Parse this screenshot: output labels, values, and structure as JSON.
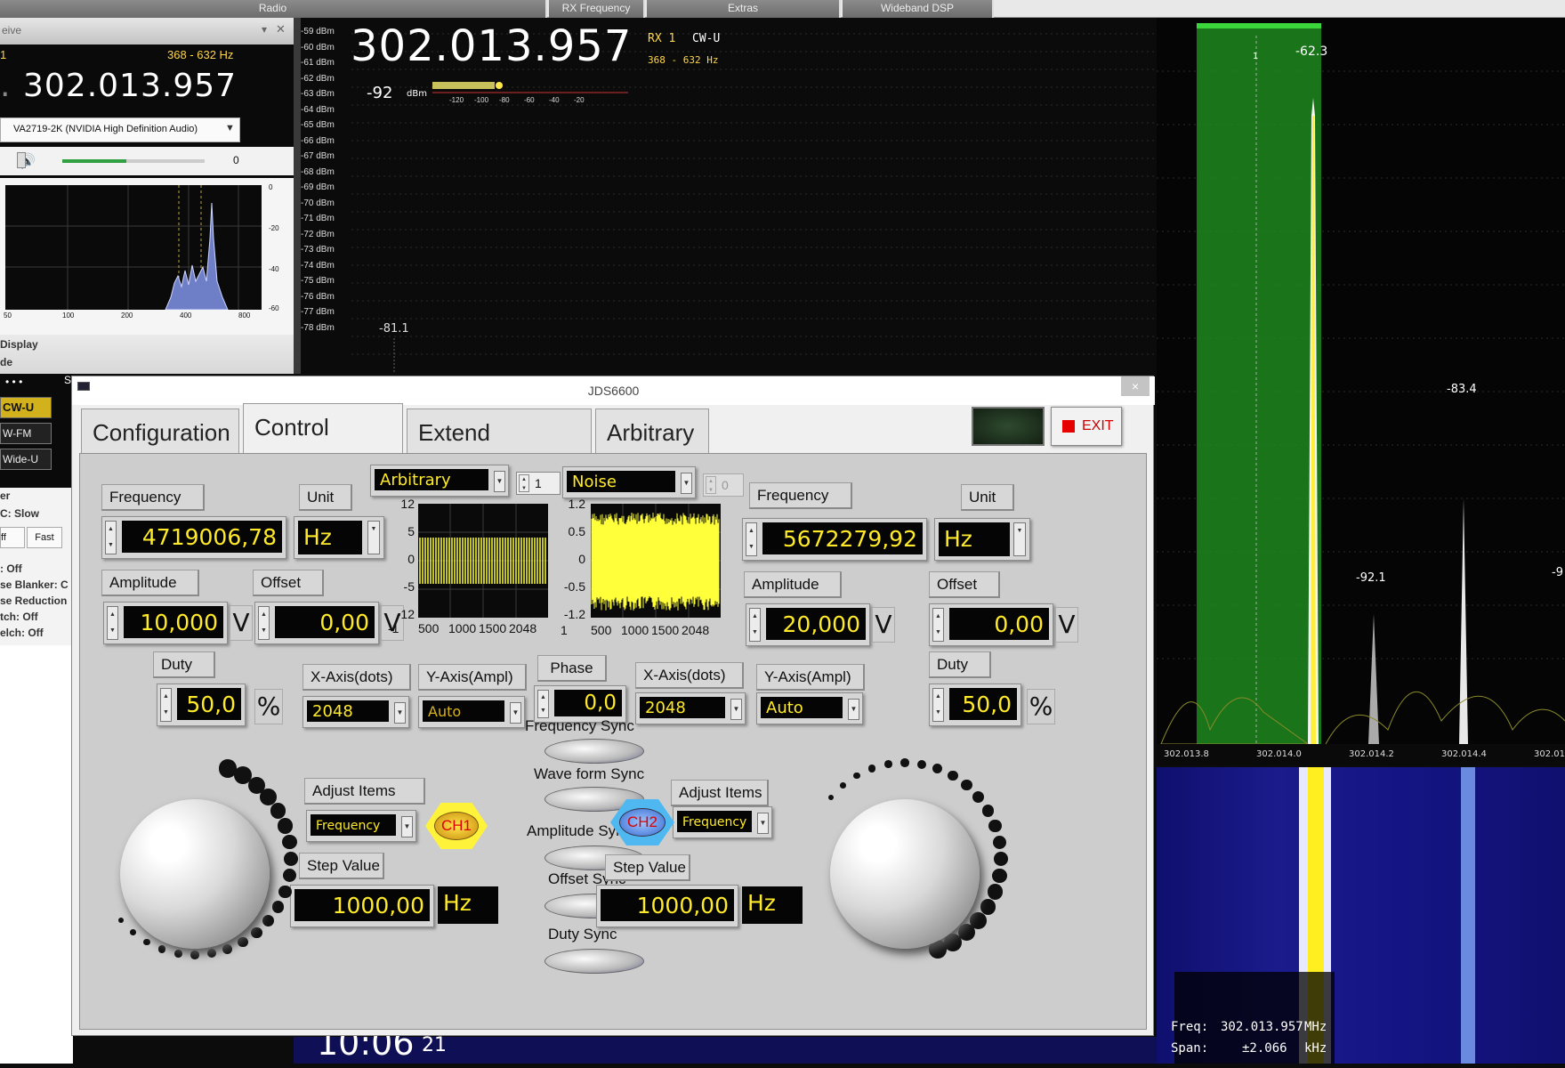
{
  "topbar": {
    "tabs": [
      "Radio",
      "RX Frequency",
      "Extras",
      "Wideband DSP"
    ]
  },
  "left_panel": {
    "title": "eive",
    "channel": "1",
    "filter_range": "368 - 632 Hz",
    "frequency": "302.013.957",
    "frequency_prefix": ".",
    "audio_device": "VA2719-2K (NVIDIA High Definition Audio)",
    "volume": "0",
    "volume_level": 0.45,
    "audio_spectrum": {
      "x_ticks": [
        "50",
        "100",
        "200",
        "400",
        "800"
      ],
      "y_ticks": [
        "0",
        "-20",
        "-40",
        "-60"
      ]
    },
    "display_label": "Display",
    "mode_label": "de",
    "dots": "• • •",
    "s_label": "S",
    "modes": [
      "CW-U",
      "W-FM",
      "Wide-U"
    ],
    "settings": [
      "er",
      "C: Slow"
    ],
    "agc_buttons": [
      "ff",
      "Fast"
    ],
    "status": [
      ": Off",
      "se Blanker: C",
      "se Reduction",
      "tch: Off",
      "elch: Off"
    ]
  },
  "main_spectrum": {
    "frequency": "302.013.957",
    "rx": "RX 1",
    "mode": "CW-U",
    "filter": "368 - 632 Hz",
    "level": "-92",
    "level_unit": "dBm",
    "smeter_ticks": [
      "-120",
      "-100",
      "-80",
      "-60",
      "-40",
      "-20"
    ],
    "dbm_labels": [
      "-59 dBm",
      "-60 dBm",
      "-61 dBm",
      "-62 dBm",
      "-63 dBm",
      "-64 dBm",
      "-65 dBm",
      "-66 dBm",
      "-67 dBm",
      "-68 dBm",
      "-69 dBm",
      "-70 dBm",
      "-71 dBm",
      "-72 dBm",
      "-73 dBm",
      "-74 dBm",
      "-75 dBm",
      "-76 dBm",
      "-77 dBm",
      "-78 dBm"
    ],
    "peak_left": "-81.1",
    "clock": "10:06",
    "clock_seconds": "21"
  },
  "right_spectrum": {
    "peak_main": "-62.3",
    "channel_marker": "1",
    "peak_2": "-83.4",
    "peak_3": "-92.1",
    "peak_4": "-9",
    "x_ticks": [
      "302.013.8",
      "302.014.0",
      "302.014.2",
      "302.014.4",
      "302.014"
    ],
    "freq_label": "Freq:",
    "freq_value": "302.013.957",
    "freq_unit": "MHz",
    "span_label": "Span:",
    "span_value": "±2.066",
    "span_unit": "kHz"
  },
  "jds": {
    "title": "JDS6600",
    "close": "×",
    "tabs": [
      "Configuration",
      "Control Panel",
      "Extend Function",
      "Arbitrary"
    ],
    "exit": "EXIT",
    "ch1": {
      "frequency_label": "Frequency",
      "frequency": "4719006,78",
      "unit_label": "Unit",
      "unit": "Hz",
      "amplitude_label": "Amplitude",
      "amplitude": "10,000",
      "amplitude_unit": "V",
      "offset_label": "Offset",
      "offset": "0,00",
      "offset_unit": "V",
      "duty_label": "Duty",
      "duty": "50,0",
      "duty_unit": "%",
      "waveform": "Arbitrary",
      "wave_index": "1",
      "x_axis_label": "X-Axis(dots)",
      "x_axis": "2048",
      "y_axis_label": "Y-Axis(Ampl)",
      "y_axis": "Auto",
      "adjust_label": "Adjust Items",
      "adjust": "Frequency",
      "step_label": "Step Value",
      "step": "1000,00",
      "step_unit": "Hz",
      "badge": "CH1",
      "plot_y": [
        "12",
        "5",
        "0",
        "-5",
        "-12"
      ],
      "plot_x": [
        "-1",
        "500",
        "1000",
        "1500",
        "2048"
      ]
    },
    "ch2": {
      "frequency_label": "Frequency",
      "frequency": "5672279,92",
      "unit_label": "Unit",
      "unit": "Hz",
      "amplitude_label": "Amplitude",
      "amplitude": "20,000",
      "amplitude_unit": "V",
      "offset_label": "Offset",
      "offset": "0,00",
      "offset_unit": "V",
      "duty_label": "Duty",
      "duty": "50,0",
      "duty_unit": "%",
      "waveform": "Noise",
      "wave_index": "0",
      "x_axis_label": "X-Axis(dots)",
      "x_axis": "2048",
      "y_axis_label": "Y-Axis(Ampl)",
      "y_axis": "Auto",
      "adjust_label": "Adjust Items",
      "adjust": "Frequency",
      "step_label": "Step Value",
      "step": "1000,00",
      "step_unit": "Hz",
      "badge": "CH2",
      "plot_y": [
        "1.2",
        "0.5",
        "0",
        "-0.5",
        "-1.2"
      ],
      "plot_x": [
        "1",
        "500",
        "1000",
        "1500",
        "2048"
      ]
    },
    "phase_label": "Phase",
    "phase": "0,0",
    "sync": [
      "Frequency Sync",
      "Wave form Sync",
      "Amplitude Sync",
      "Offset Sync",
      "Duty Sync"
    ]
  }
}
